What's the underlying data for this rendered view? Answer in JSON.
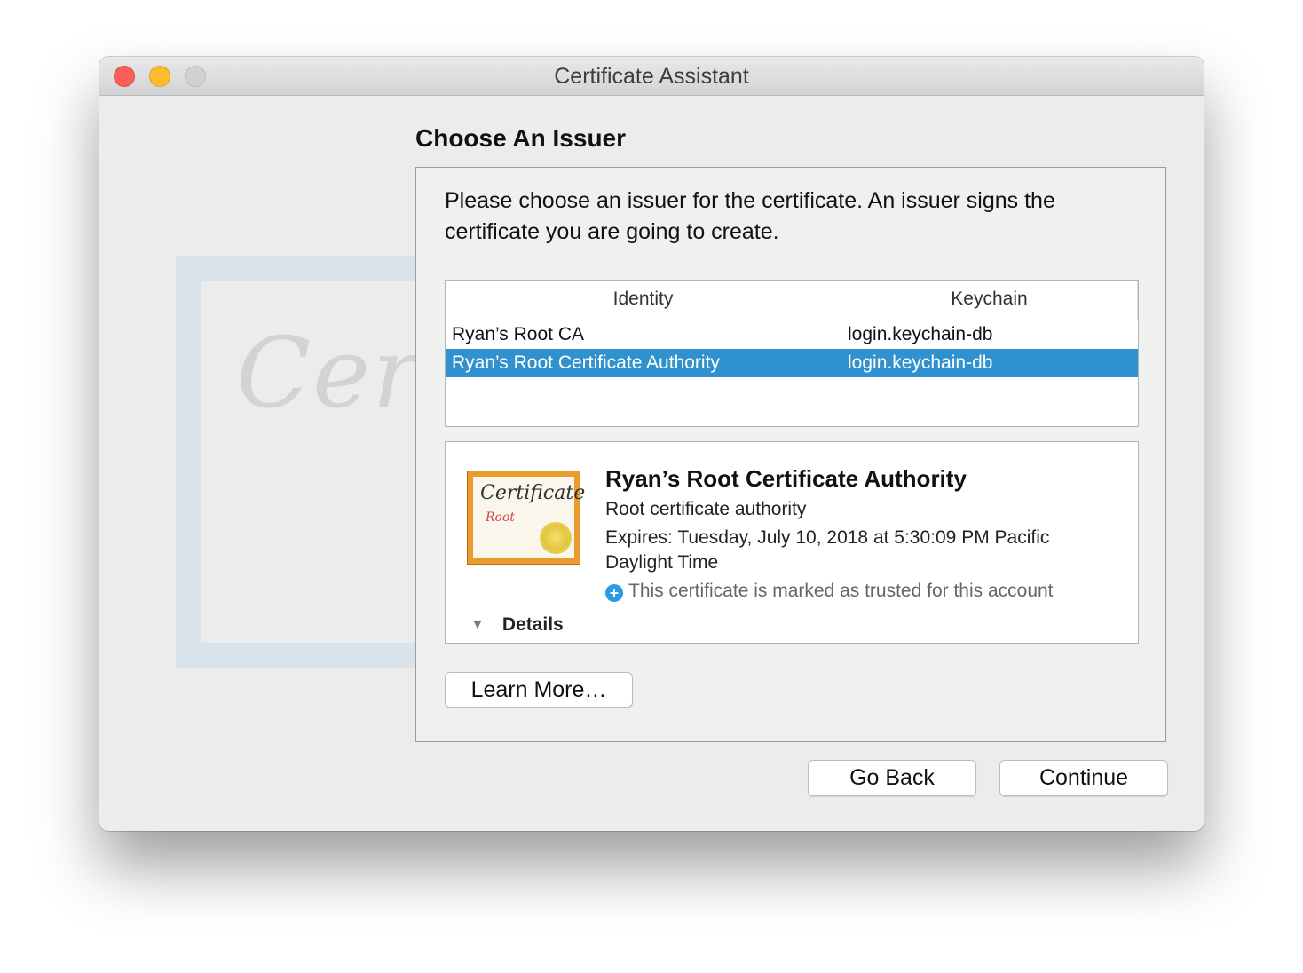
{
  "window": {
    "title": "Certificate Assistant"
  },
  "watermark": {
    "text": "Certi"
  },
  "page": {
    "heading": "Choose An Issuer",
    "intro": "Please choose an issuer for the certificate. An issuer signs the certificate you are going to create."
  },
  "table": {
    "columns": [
      "Identity",
      "Keychain"
    ],
    "rows": [
      {
        "identity": "Ryan’s Root CA",
        "keychain": "login.keychain-db",
        "selected": false
      },
      {
        "identity": "Ryan’s Root Certificate Authority",
        "keychain": "login.keychain-db",
        "selected": true
      }
    ]
  },
  "details_panel": {
    "icon": "certificate-icon",
    "icon_title": "Certificate",
    "icon_subtitle": "Root",
    "name": "Ryan’s Root Certificate Authority",
    "kind": "Root certificate authority",
    "expires": "Expires: Tuesday, July 10, 2018 at 5:30:09 PM Pacific Daylight Time",
    "trust_icon": "plus-circle-icon",
    "trust": "This certificate is marked as trusted for this account",
    "details_label": "Details"
  },
  "buttons": {
    "learn_more": "Learn More…",
    "go_back": "Go Back",
    "continue": "Continue"
  },
  "colors": {
    "selection": "#2f92cf",
    "close": "#fc5f57",
    "minimize": "#fdbc2e",
    "zoom": "#d1d1d1",
    "trust_icon": "#2b9be4"
  }
}
